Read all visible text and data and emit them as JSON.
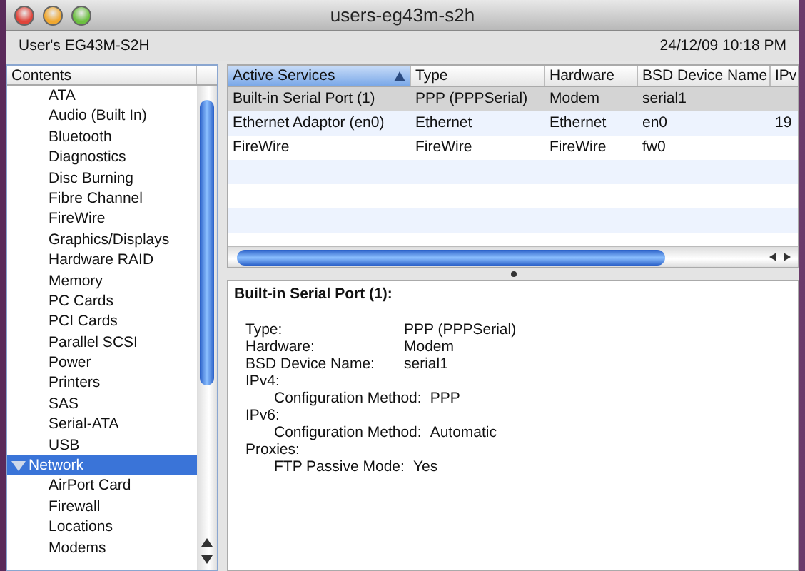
{
  "window": {
    "title": "users-eg43m-s2h"
  },
  "info_bar": {
    "computer": "User's EG43M-S2H",
    "date": "24/12/09 10:18 PM"
  },
  "sidebar": {
    "header": "Contents",
    "items": [
      {
        "children": [
          {
            "label": "ATA",
            "selected": false
          },
          {
            "label": "Audio (Built In)",
            "selected": false
          },
          {
            "label": "Bluetooth",
            "selected": false
          },
          {
            "label": "Diagnostics",
            "selected": false
          },
          {
            "label": "Disc Burning",
            "selected": false
          },
          {
            "label": "Fibre Channel",
            "selected": false
          },
          {
            "label": "FireWire",
            "selected": false
          },
          {
            "label": "Graphics/Displays",
            "selected": false
          },
          {
            "label": "Hardware RAID",
            "selected": false
          },
          {
            "label": "Memory",
            "selected": false
          },
          {
            "label": "PC Cards",
            "selected": false
          },
          {
            "label": "PCI Cards",
            "selected": false
          },
          {
            "label": "Parallel SCSI",
            "selected": false
          },
          {
            "label": "Power",
            "selected": false
          },
          {
            "label": "Printers",
            "selected": false
          },
          {
            "label": "SAS",
            "selected": false
          },
          {
            "label": "Serial-ATA",
            "selected": false
          },
          {
            "label": "USB",
            "selected": false
          }
        ]
      },
      {
        "label": "Network",
        "selected": true,
        "expanded": true,
        "children": [
          {
            "label": "AirPort Card",
            "selected": false
          },
          {
            "label": "Firewall",
            "selected": false
          },
          {
            "label": "Locations",
            "selected": false
          },
          {
            "label": "Modems",
            "selected": false
          }
        ]
      }
    ]
  },
  "table": {
    "columns": [
      {
        "label": "Active Services",
        "selected": true
      },
      {
        "label": "Type",
        "selected": false
      },
      {
        "label": "Hardware",
        "selected": false
      },
      {
        "label": "BSD Device Name",
        "selected": false
      },
      {
        "label": "IPv",
        "selected": false
      }
    ],
    "rows": [
      {
        "selected": true,
        "cells": [
          "Built-in Serial Port (1)",
          "PPP (PPPSerial)",
          "Modem",
          "serial1",
          ""
        ]
      },
      {
        "selected": false,
        "cells": [
          "Ethernet Adaptor (en0)",
          "Ethernet",
          "Ethernet",
          "en0",
          "19"
        ]
      },
      {
        "selected": false,
        "cells": [
          "FireWire",
          "FireWire",
          "FireWire",
          "fw0",
          ""
        ]
      }
    ]
  },
  "detail": {
    "title": "Built-in Serial Port (1):",
    "items": [
      {
        "label": "Type:",
        "value": "PPP (PPPSerial)"
      },
      {
        "label": "Hardware:",
        "value": "Modem"
      },
      {
        "label": "BSD Device Name:",
        "value": "serial1"
      },
      {
        "label": "IPv4:",
        "children": [
          {
            "label": "Configuration Method:",
            "value": "PPP"
          }
        ]
      },
      {
        "label": "IPv6:",
        "children": [
          {
            "label": "Configuration Method:",
            "value": "Automatic"
          }
        ]
      },
      {
        "label": "Proxies:",
        "children": [
          {
            "label": "FTP Passive Mode:",
            "value": "Yes"
          }
        ]
      }
    ]
  }
}
